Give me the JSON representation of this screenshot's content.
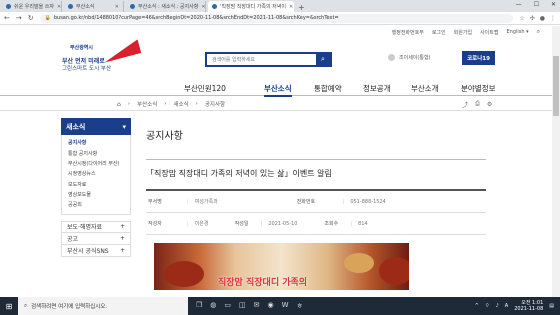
{
  "browser": {
    "tabs": [
      {
        "label": "쉬운 우리말을 쓰자"
      },
      {
        "label": "부산소식"
      },
      {
        "label": "부산소식 : 새소식 : 공지사항"
      },
      {
        "label": "'직장맘 직장대디 가족의 저녁이"
      }
    ],
    "new_tab": "+",
    "url": "busan.go.kr/nbd/1488010?curPage=46&srchBeginDt=2020-11-08&srchEndDt=2021-11-08&srchKey=&srchText="
  },
  "site": {
    "util_links": [
      "행정전화번호부",
      "로그인",
      "회원가입",
      "사이트맵",
      "English"
    ],
    "logo_small": "부산광역시",
    "logo_line1": "부산 먼저 미래로",
    "logo_line2": "그린스마트 도시 부산",
    "search_placeholder": "검색어를 입력하세요",
    "login_text": "조이세이(통합)",
    "covid_label": "코로나19",
    "gnb": [
      "부산민원120",
      "부산소식",
      "통합예약",
      "정보공개",
      "부산소개",
      "분야별정보"
    ],
    "breadcrumb": [
      "부산소식",
      "새소식",
      "공지사항"
    ]
  },
  "lnb": {
    "title": "새소식",
    "sub_items": [
      "공지사항",
      "통합 공지사항",
      "부산시정(다이어리 부산)",
      "시정영상뉴스",
      "보도자료",
      "영상보도물",
      "공공외"
    ],
    "menus": [
      "보도·해명자료",
      "공고",
      "부산시 공식SNS"
    ]
  },
  "content": {
    "page_title": "공지사항",
    "post_title": "「직장맘 직장대디 가족의 저녁이 있는 삶」이벤트 알림",
    "rows": [
      [
        {
          "label": "부서명",
          "value": "여성가족과"
        },
        {
          "label": "전화번호",
          "value": "051-888-1524"
        }
      ],
      [
        {
          "label": "작성자",
          "value": "이은경"
        },
        {
          "label": "작성일",
          "value": "2021-05-10"
        },
        {
          "label": "조회수",
          "value": "814"
        }
      ]
    ],
    "poster_text": "직장맘 직장대디 가족의"
  },
  "taskbar": {
    "search_placeholder": "검색하려면 여기에 입력하십시오.",
    "time": "오전 1:01",
    "date": "2021-11-08",
    "lang": "A"
  }
}
